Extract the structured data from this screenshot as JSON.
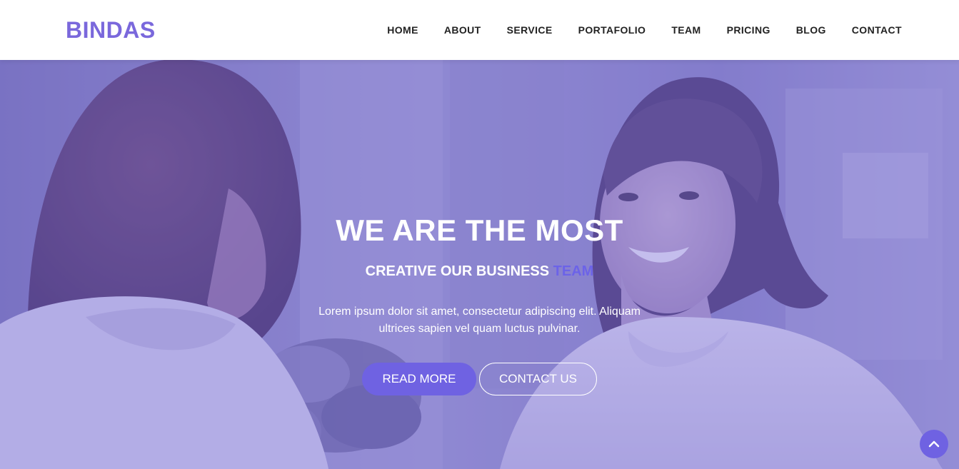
{
  "header": {
    "logo": "BINDAS",
    "nav": [
      {
        "label": "HOME"
      },
      {
        "label": "ABOUT"
      },
      {
        "label": "SERVICE"
      },
      {
        "label": "PORTAFOLIO"
      },
      {
        "label": "TEAM"
      },
      {
        "label": "PRICING"
      },
      {
        "label": "BLOG"
      },
      {
        "label": "CONTACT"
      }
    ]
  },
  "hero": {
    "title": "WE ARE THE MOST",
    "subtitle": "CREATIVE OUR BUSINESS",
    "subtitle_accent": "TEAM",
    "text": "Lorem ipsum dolor sit amet, consectetur adipiscing elit. Aliquam ultrices sapien vel quam luctus pulvinar.",
    "primary_button": "READ MORE",
    "secondary_button": "CONTACT US"
  },
  "scroll_top": {
    "icon": "chevron-up-icon"
  },
  "colors": {
    "brand": "#7a68dc",
    "accent": "#6c63e8",
    "button": "#6f62e2",
    "overlay": "#7064d7",
    "nav_text": "#222222"
  }
}
